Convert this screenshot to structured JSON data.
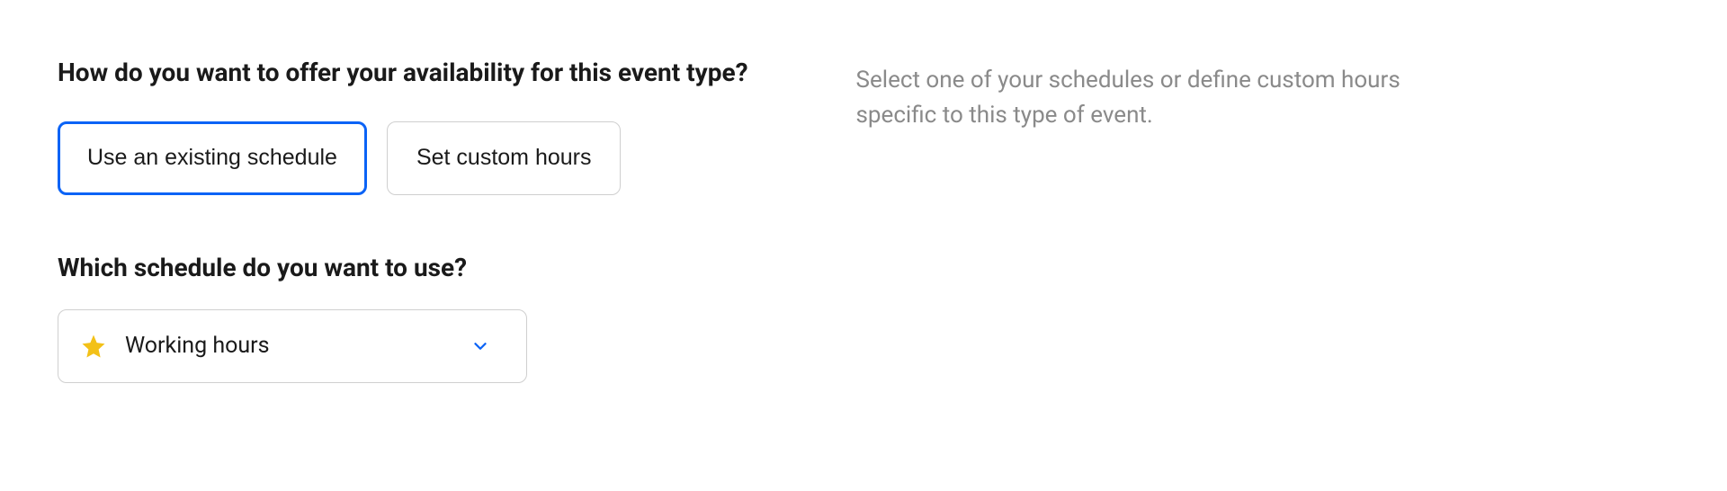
{
  "availability": {
    "heading": "How do you want to offer your availability for this event type?",
    "options": {
      "existing": "Use an existing schedule",
      "custom": "Set custom hours"
    },
    "schedule_heading": "Which schedule do you want to use?",
    "selected_schedule": "Working hours"
  },
  "help": {
    "text": "Select one of your schedules or define custom hours specific to this type of event."
  },
  "colors": {
    "accent": "#0b63f6",
    "star": "#f3c118",
    "muted": "#8a8a8a"
  }
}
